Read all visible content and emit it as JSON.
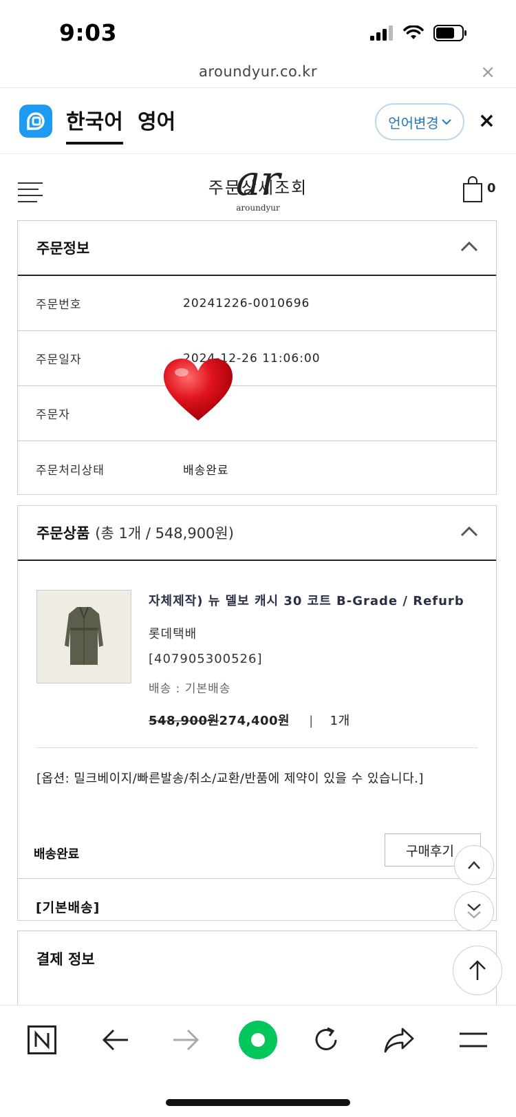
{
  "status_bar": {
    "time": "9:03"
  },
  "url_bar": {
    "url": "aroundyur.co.kr",
    "close": "×"
  },
  "translate_bar": {
    "tabs": [
      "한국어",
      "영어"
    ],
    "change_language": "언어변경",
    "close": "×"
  },
  "header": {
    "logo_mark": "ar",
    "logo_text": "aroundyur",
    "page_title": "주문상세조회",
    "cart_count": "0"
  },
  "order_info": {
    "title": "주문정보",
    "rows": [
      {
        "label": "주문번호",
        "value": "20241226-0010696"
      },
      {
        "label": "주문일자",
        "value": "2024-12-26 11:06:00"
      },
      {
        "label": "주문자",
        "value": ""
      },
      {
        "label": "주문처리상태",
        "value": "배송완료"
      }
    ]
  },
  "order_items": {
    "title": "주문상품",
    "summary": "(총 1개 / 548,900원)",
    "product": {
      "name": "자체제작) 뉴 델보 캐시 30 코트 B-Grade / Refurb",
      "carrier": "롯데택배",
      "tracking": "[407905300526]",
      "shipping": "배송 : 기본배송",
      "original_price": "548,900원",
      "sale_price": "274,400원",
      "separator": "|",
      "quantity": "1개"
    },
    "options": "[옵션: 밀크베이지/빠른발송/취소/교환/반품에 제약이 있을 수 있습니다.]",
    "status": "배송완료",
    "review_button": "구매후기",
    "shipping_type": "[기본배송]"
  },
  "payment": {
    "title": "결제 정보"
  },
  "colors": {
    "accent": "#1e9af0",
    "naver_green": "#03c75a",
    "heart": "#e0141e"
  }
}
